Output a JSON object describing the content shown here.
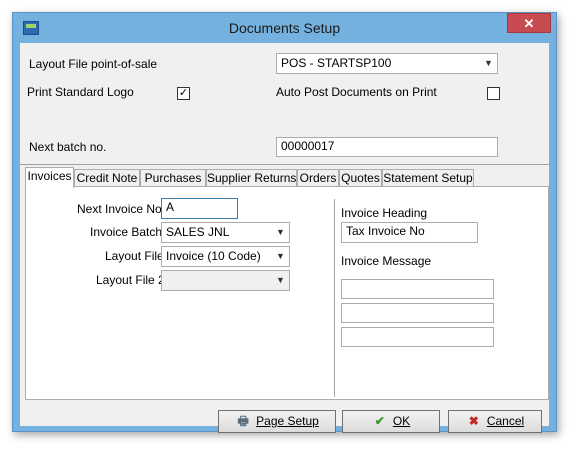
{
  "window": {
    "title": "Documents Setup",
    "close_glyph": "✕"
  },
  "top": {
    "layout_label": "Layout File point-of-sale",
    "layout_value": "POS - STARTSP100",
    "print_logo_label": "Print Standard Logo",
    "print_logo_checked": true,
    "auto_post_label": "Auto Post Documents on Print",
    "auto_post_checked": false,
    "batch_label": "Next batch no.",
    "batch_value": "00000017"
  },
  "tabs": [
    "Invoices",
    "Credit Note",
    "Purchases",
    "Supplier Returns",
    "Orders",
    "Quotes",
    "Statement Setup"
  ],
  "active_tab": "Invoices",
  "invoices": {
    "next_invoice_label": "Next Invoice No.",
    "next_invoice_value": "A",
    "batch_label": "Invoice Batch",
    "batch_value": "SALES JNL",
    "layout_label": "Layout File",
    "layout_value": "Invoice (10 Code)",
    "layout2_label": "Layout File 2",
    "layout2_value": "",
    "heading_label": "Invoice Heading",
    "heading_value": "Tax Invoice No",
    "message_label": "Invoice Message",
    "message_lines": [
      "",
      "",
      ""
    ]
  },
  "buttons": {
    "page_setup_label": "Page Setup",
    "ok_label": "OK",
    "cancel_label": "Cancel"
  },
  "icons": {
    "check": "✓",
    "dropdown": "▼",
    "ok": "✔",
    "cancel": "✖",
    "printer": "🖶"
  },
  "colors": {
    "title_bar": "#74b1df",
    "close_button": "#c74b50",
    "ok_icon": "#3a9a2a",
    "cancel_icon": "#c62828"
  }
}
